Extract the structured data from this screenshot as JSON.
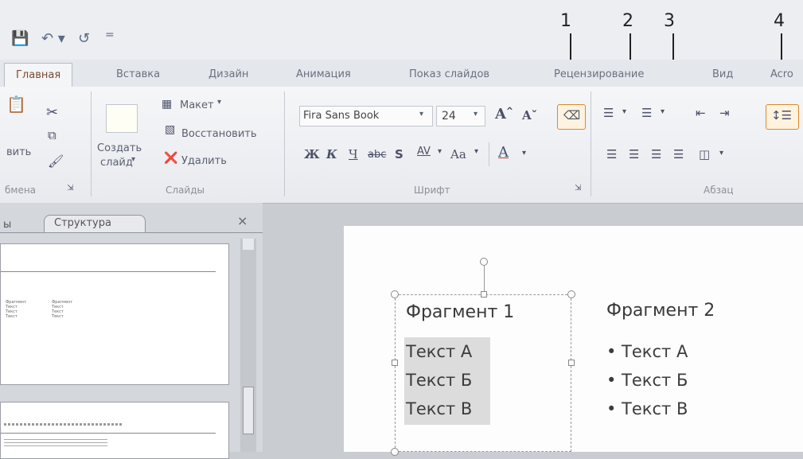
{
  "qat": {
    "save_icon": "save-icon",
    "undo_icon": "undo-icon",
    "redo_icon": "redo-icon",
    "customize": "="
  },
  "tabs": [
    "Главная",
    "Вставка",
    "Дизайн",
    "Анимация",
    "Показ слайдов",
    "Рецензирование",
    "Вид",
    "Acro"
  ],
  "ribbon": {
    "clipboard": {
      "paste_label": "вить",
      "group": "Буфер обмена",
      "group_visible": "бмена"
    },
    "slides": {
      "new_slide": "Создать",
      "new_slide2": "слайд",
      "layout": "Макет",
      "reset": "Восстановить",
      "delete": "Удалить",
      "group": "Слайды"
    },
    "font": {
      "family": "Fira Sans Book",
      "size": "24",
      "bold": "Ж",
      "italic": "К",
      "underline": "Ч",
      "strike": "abc",
      "shadow": "S",
      "spacing": "AV",
      "case": "Aa",
      "color": "A",
      "group": "Шрифт"
    },
    "paragraph": {
      "group": "Абзац"
    }
  },
  "callouts": [
    "1",
    "2",
    "3",
    "4"
  ],
  "panel": {
    "tab_slides": "ы",
    "tab_structure": "Структура",
    "close": "×",
    "thumb1_col1": [
      "Фрагмент",
      "Текст",
      "Текст",
      "Текст"
    ],
    "thumb1_col2": [
      "Фрагмент",
      "Текст",
      "Текст",
      "Текст"
    ]
  },
  "slide": {
    "frag1_title": "Фрагмент 1",
    "frag1_items": [
      "Текст А",
      "Текст Б",
      "Текст В"
    ],
    "frag2_title": "Фрагмент 2",
    "frag2_items": [
      "• Текст А",
      "• Текст Б",
      "• Текст В"
    ]
  },
  "colors": {
    "accent": "#d98a2a",
    "tab_active": "#7a4a30"
  }
}
